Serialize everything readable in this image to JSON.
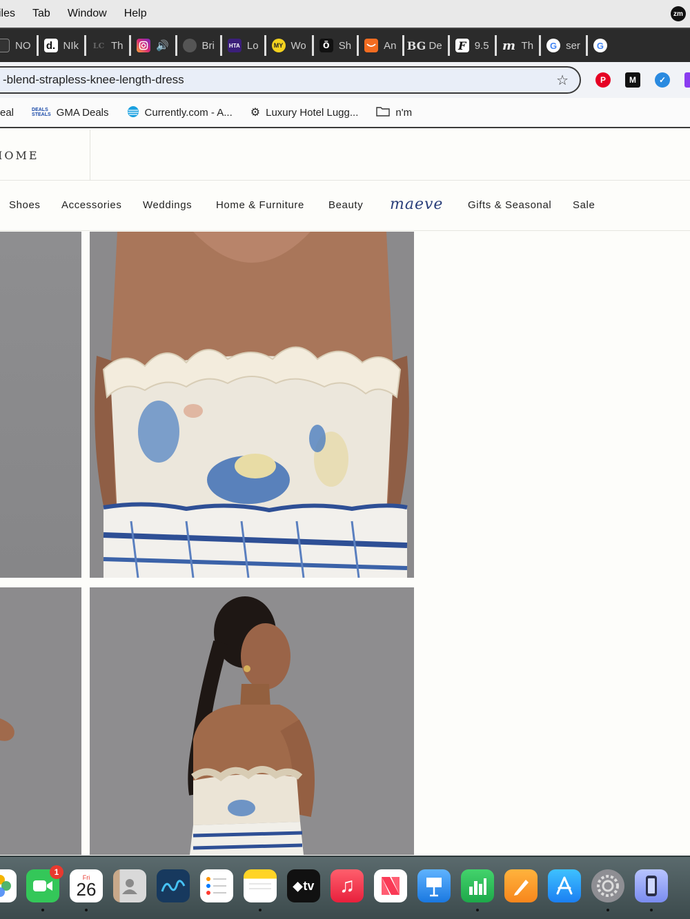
{
  "menubar": {
    "items": [
      "iles",
      "Tab",
      "Window",
      "Help"
    ],
    "zoom_badge": "zm"
  },
  "tabs": [
    {
      "label": "NO",
      "icon": "nordstrom-icon",
      "color": "#333333"
    },
    {
      "label": "NIk",
      "icon": "d-icon",
      "color": "#ffffff"
    },
    {
      "label": "Th",
      "icon": "lc-icon",
      "color": "#555555"
    },
    {
      "label": "",
      "icon": "instagram-icon",
      "color": "#d62976"
    },
    {
      "label": "",
      "icon": "audio-icon",
      "color": "#2b2b2b"
    },
    {
      "label": "Bri",
      "icon": "globe-icon",
      "color": "#555555"
    },
    {
      "label": "Lo",
      "icon": "hta-icon",
      "color": "#3b1f7a"
    },
    {
      "label": "Wo",
      "icon": "my-icon",
      "color": "#f4d21f"
    },
    {
      "label": "Sh",
      "icon": "ring-icon",
      "color": "#111111"
    },
    {
      "label": "An",
      "icon": "amazon-icon",
      "color": "#f36c21"
    },
    {
      "label": "De",
      "icon": "bg-icon",
      "color": "#2b2b2b"
    },
    {
      "label": "9.5",
      "icon": "script-f-icon",
      "color": "#2b2b2b"
    },
    {
      "label": "Th",
      "icon": "script-m-icon",
      "color": "#2b2b2b"
    },
    {
      "label": "ser",
      "icon": "google-icon",
      "color": "#ffffff"
    },
    {
      "label": "",
      "icon": "google-icon",
      "color": "#ffffff"
    }
  ],
  "address": {
    "url": "-blend-strapless-knee-length-dress"
  },
  "bookmarks": [
    {
      "label": "eal",
      "icon": ""
    },
    {
      "label": "GMA Deals",
      "icon": "gma-deals-icon"
    },
    {
      "label": "Currently.com - A...",
      "icon": "att-icon"
    },
    {
      "label": "Luxury Hotel Lugg...",
      "icon": "openai-icon"
    },
    {
      "label": "n'm",
      "icon": "folder-icon"
    }
  ],
  "site": {
    "logo": "IOME"
  },
  "nav": {
    "items": [
      "Shoes",
      "Accessories",
      "Weddings",
      "Home & Furniture",
      "Beauty",
      "maeve",
      "Gifts & Seasonal",
      "Sale"
    ]
  },
  "dock": {
    "facetime_badge": "1",
    "calendar_day": "Fri",
    "calendar_date": "26",
    "apps": [
      "photos-icon",
      "facetime-icon",
      "calendar-icon",
      "contacts-icon",
      "freeform-icon",
      "reminders-icon",
      "notes-icon",
      "apple-tv-icon",
      "music-icon",
      "news-icon",
      "keynote-icon",
      "numbers-icon",
      "pages-icon",
      "app-store-icon",
      "system-settings-icon",
      "iphone-mirroring-icon"
    ],
    "tv_label": "tv"
  }
}
